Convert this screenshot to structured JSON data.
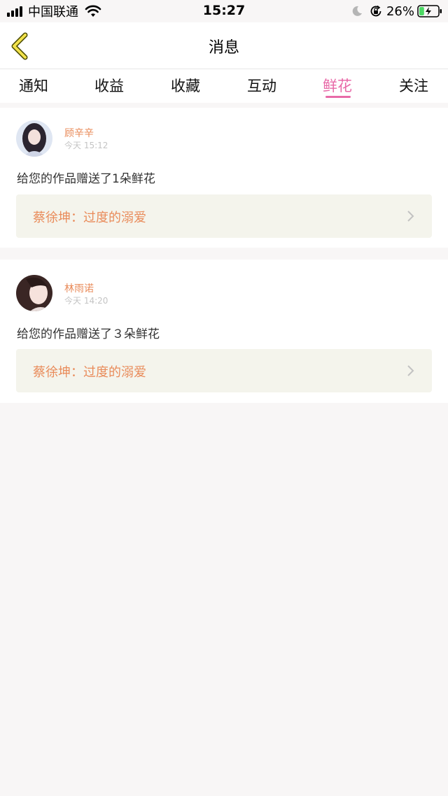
{
  "status_bar": {
    "carrier": "中国联通",
    "time": "15:27",
    "battery_percent": "26%",
    "battery_level": 0.26,
    "icons": [
      "signal-icon",
      "wifi-icon",
      "moon-icon",
      "rotation-lock-icon",
      "battery-charging-icon"
    ]
  },
  "header": {
    "back_icon": "chevron-left-icon",
    "title": "消息"
  },
  "tabs": [
    {
      "label": "通知"
    },
    {
      "label": "收益"
    },
    {
      "label": "收藏"
    },
    {
      "label": "互动"
    },
    {
      "label": "鲜花"
    },
    {
      "label": "关注"
    }
  ],
  "active_tab": "鲜花",
  "messages": [
    {
      "user": "顾辛辛",
      "time": "今天 15:12",
      "text": "给您的作品赠送了1朵鲜花",
      "work": "蔡徐坤：过度的溺爱"
    },
    {
      "user": "林雨诺",
      "time": "今天 14:20",
      "text": "给您的作品赠送了３朵鲜花",
      "work": "蔡徐坤：过度的溺爱"
    }
  ],
  "colors": {
    "accent": "#e86aa8",
    "username": "#e98b5a",
    "work_bg": "#f4f4ec",
    "page_bg": "#f8f6f6"
  }
}
